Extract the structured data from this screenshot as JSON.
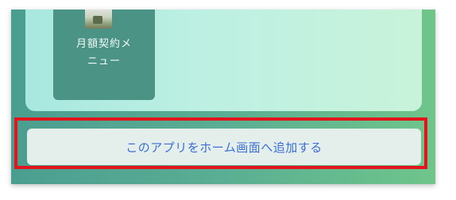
{
  "menu_tile": {
    "label_line1": "月額契約メ",
    "label_line2": "ニュー"
  },
  "add_to_home": {
    "label": "このアプリをホーム画面へ追加する"
  },
  "colors": {
    "highlight_border": "#e3141c",
    "button_text": "#3b6fd6",
    "frame_bg": "#5aae93"
  }
}
